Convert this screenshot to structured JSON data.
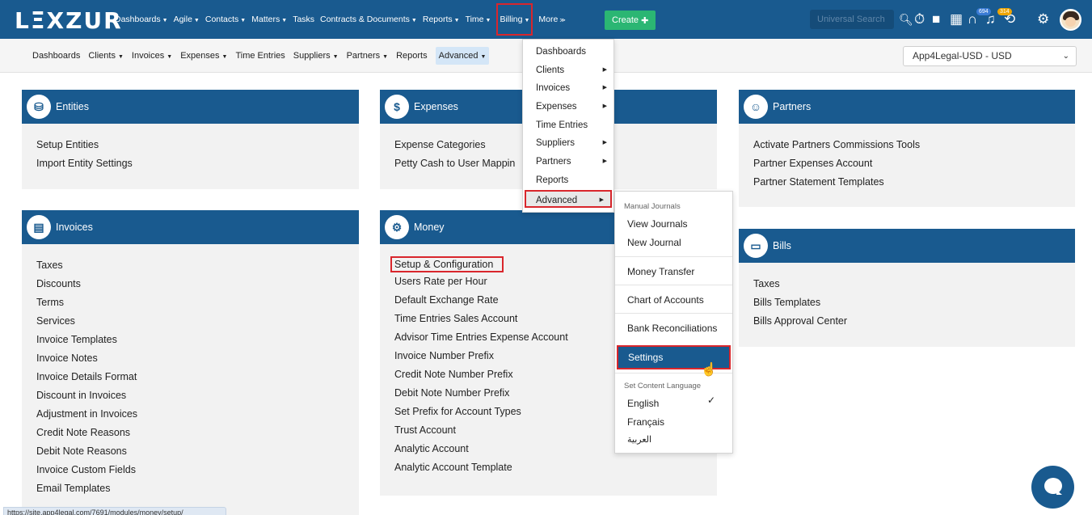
{
  "app": {
    "logo": "LΞXZUR"
  },
  "topnav": {
    "items": [
      "Dashboards",
      "Agile",
      "Contacts",
      "Matters",
      "Tasks",
      "Contracts & Documents",
      "Reports",
      "Time",
      "Billing",
      "More"
    ],
    "create_label": "Create",
    "search_placeholder": "Universal Search",
    "badges": {
      "notifications": "694",
      "reminders": "314"
    }
  },
  "subnav": {
    "items": [
      "Dashboards",
      "Clients",
      "Invoices",
      "Expenses",
      "Time Entries",
      "Suppliers",
      "Partners",
      "Reports",
      "Advanced"
    ],
    "currency_selected": "App4Legal-USD - USD"
  },
  "cards": {
    "entities": {
      "title": "Entities",
      "items": [
        "Setup Entities",
        "Import Entity Settings"
      ]
    },
    "expenses": {
      "title": "Expenses",
      "items": [
        "Expense Categories",
        "Petty Cash to User Mappin"
      ]
    },
    "partners": {
      "title": "Partners",
      "items": [
        "Activate Partners Commissions Tools",
        "Partner Expenses Account",
        "Partner Statement Templates"
      ]
    },
    "invoices": {
      "title": "Invoices",
      "items": [
        "Taxes",
        "Discounts",
        "Terms",
        "Services",
        "Invoice Templates",
        "Invoice Notes",
        "Invoice Details Format",
        "Discount in Invoices",
        "Adjustment in Invoices",
        "Credit Note Reasons",
        "Debit Note Reasons",
        "Invoice Custom Fields",
        "Email Templates"
      ]
    },
    "money": {
      "title": "Money",
      "items": [
        "Setup & Configuration",
        "Users Rate per Hour",
        "Default Exchange Rate",
        "Time Entries Sales Account",
        "Advisor Time Entries Expense Account",
        "Invoice Number Prefix",
        "Credit Note Number Prefix",
        "Debit Note Number Prefix",
        "Set Prefix for Account Types",
        "Trust Account",
        "Analytic Account",
        "Analytic Account Template"
      ]
    },
    "bills": {
      "title": "Bills",
      "items": [
        "Taxes",
        "Bills Templates",
        "Bills Approval Center"
      ]
    }
  },
  "billing_menu": {
    "items": [
      "Dashboards",
      "Clients",
      "Invoices",
      "Expenses",
      "Time Entries",
      "Suppliers",
      "Partners",
      "Reports",
      "Advanced"
    ]
  },
  "advanced_menu": {
    "header_journals": "Manual Journals",
    "view_journals": "View Journals",
    "new_journal": "New Journal",
    "money_transfer": "Money Transfer",
    "chart_of_accounts": "Chart of Accounts",
    "bank_reconciliations": "Bank Reconciliations",
    "settings": "Settings",
    "header_language": "Set Content Language",
    "english": "English",
    "francais": "Français",
    "arabic": "العربية"
  },
  "status_url": "https://site.app4legal.com/7691/modules/money/setup/"
}
